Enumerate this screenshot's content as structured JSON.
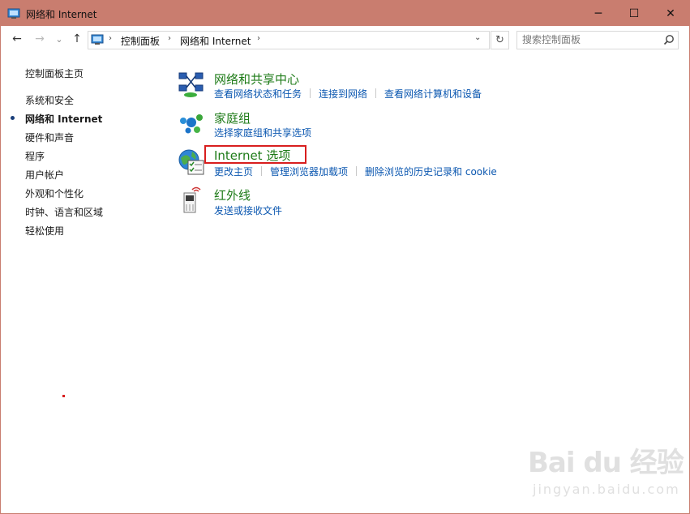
{
  "window": {
    "title": "网络和 Internet",
    "title_color": "#c97d6f"
  },
  "controls": {
    "minimize": "─",
    "maximize": "☐",
    "close": "✕"
  },
  "nav": {
    "back": "←",
    "forward": "→",
    "recent": "⌄",
    "up": "↑"
  },
  "address": {
    "crumbs": [
      "控制面板",
      "网络和 Internet"
    ],
    "separator": "›",
    "dropdown": "⌄",
    "refresh": "↻"
  },
  "search": {
    "placeholder": "搜索控制面板"
  },
  "sidebar": {
    "items": [
      {
        "label": "控制面板主页"
      },
      {
        "label": "系统和安全"
      },
      {
        "label": "网络和 Internet",
        "current": true
      },
      {
        "label": "硬件和声音"
      },
      {
        "label": "程序"
      },
      {
        "label": "用户帐户"
      },
      {
        "label": "外观和个性化"
      },
      {
        "label": "时钟、语言和区域"
      },
      {
        "label": "轻松使用"
      }
    ]
  },
  "categories": [
    {
      "title": "网络和共享中心",
      "icon": "network-center-icon",
      "links": [
        "查看网络状态和任务",
        "连接到网络",
        "查看网络计算机和设备"
      ]
    },
    {
      "title": "家庭组",
      "icon": "homegroup-icon",
      "links": [
        "选择家庭组和共享选项"
      ]
    },
    {
      "title": "Internet 选项",
      "icon": "internet-options-icon",
      "links": [
        "更改主页",
        "管理浏览器加载项",
        "删除浏览的历史记录和 cookie"
      ]
    },
    {
      "title": "红外线",
      "icon": "infrared-icon",
      "links": [
        "发送或接收文件"
      ]
    }
  ],
  "watermark": {
    "main": "Bai du 经验",
    "sub": "jingyan.baidu.com"
  },
  "colors": {
    "category_title": "#1e7b18",
    "link": "#0b57b0",
    "highlight": "#d81e1e"
  }
}
